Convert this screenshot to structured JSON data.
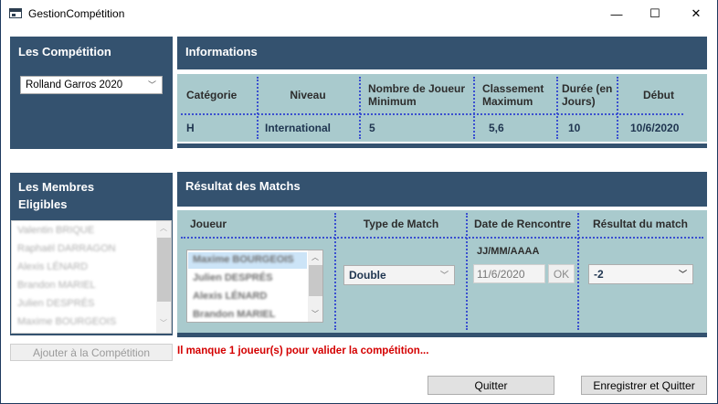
{
  "window": {
    "title": "GestionCompétition",
    "minimize": "—",
    "maximize": "☐",
    "close": "✕"
  },
  "competitions": {
    "header": "Les Compétition",
    "selected": "Rolland Garros 2020"
  },
  "informations": {
    "header": "Informations",
    "columns": [
      "Catégorie",
      "Niveau",
      "Nombre de Joueur Minimum",
      "Classement Maximum",
      "Durée (en Jours)",
      "Début"
    ],
    "values": [
      "H",
      "International",
      "5",
      "5,6",
      "10",
      "10/6/2020"
    ]
  },
  "members": {
    "header": "Les Membres Eligibles",
    "items": [
      "Valentin BRIQUE",
      "Raphaël DARRAGON",
      "Alexis LÉNARD",
      "Brandon MARIEL",
      "Julien DESPRÉS",
      "Maxime BOURGEOIS"
    ],
    "add_button": "Ajouter à la Compétition"
  },
  "results": {
    "header": "Résultat des Matchs",
    "columns": [
      "Joueur",
      "Type de Match",
      "Date de Rencontre",
      "Résultat du match"
    ],
    "players": [
      "Maxime BOURGEOIS",
      "Julien DESPRÉS",
      "Alexis LÉNARD",
      "Brandon MARIEL"
    ],
    "match_type": "Double",
    "date_format": "JJ/MM/AAAA",
    "date_value": "11/6/2020",
    "ok_button": "OK",
    "result_value": "-2"
  },
  "warning": "Il manque 1 joueur(s) pour valider la compétition...",
  "buttons": {
    "quit": "Quitter",
    "save_quit": "Enregistrer et Quitter"
  }
}
